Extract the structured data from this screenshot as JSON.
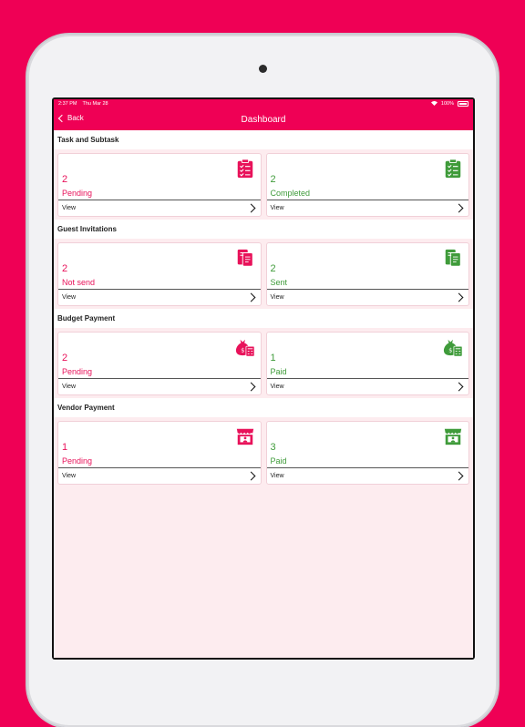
{
  "status_bar": {
    "time": "2:37 PM",
    "date": "Thu Mar 28",
    "battery": "100%"
  },
  "nav": {
    "back_label": "Back",
    "title": "Dashboard"
  },
  "sections": [
    {
      "title": "Task and Subtask",
      "cards": [
        {
          "count": "2",
          "label": "Pending",
          "view": "View",
          "icon": "clipboard-checklist-icon"
        },
        {
          "count": "2",
          "label": "Completed",
          "view": "View",
          "icon": "clipboard-checklist-icon"
        }
      ]
    },
    {
      "title": "Guest Invitations",
      "cards": [
        {
          "count": "2",
          "label": "Not send",
          "view": "View",
          "icon": "invitation-card-icon"
        },
        {
          "count": "2",
          "label": "Sent",
          "view": "View",
          "icon": "invitation-card-icon"
        }
      ]
    },
    {
      "title": "Budget Payment",
      "cards": [
        {
          "count": "2",
          "label": "Pending",
          "view": "View",
          "icon": "money-bag-calculator-icon"
        },
        {
          "count": "1",
          "label": "Paid",
          "view": "View",
          "icon": "money-bag-calculator-icon"
        }
      ]
    },
    {
      "title": "Vendor Payment",
      "cards": [
        {
          "count": "1",
          "label": "Pending",
          "view": "View",
          "icon": "vendor-stall-icon"
        },
        {
          "count": "3",
          "label": "Paid",
          "view": "View",
          "icon": "vendor-stall-icon"
        }
      ]
    }
  ],
  "colors": {
    "accent": "#ef0055",
    "pending": "#e8125a",
    "done": "#3f9b3a",
    "background": "#fdecef"
  }
}
